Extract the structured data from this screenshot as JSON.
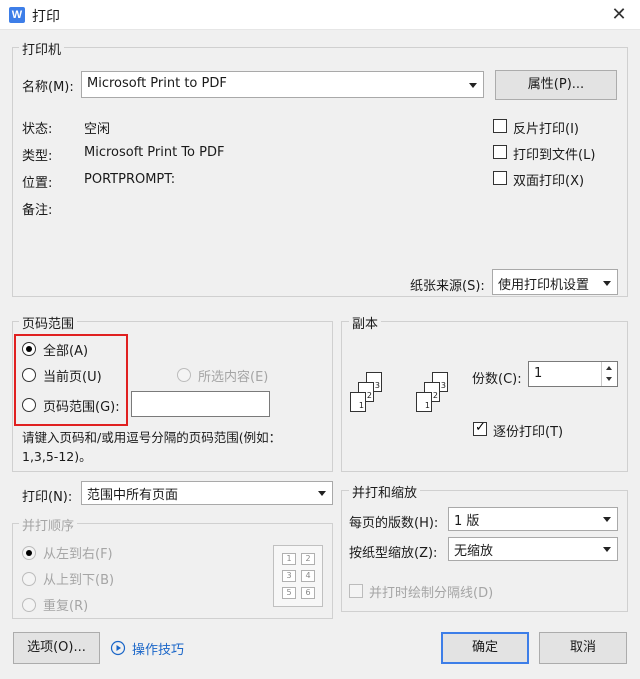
{
  "window": {
    "title": "打印",
    "app_icon": "W"
  },
  "printer": {
    "group_title": "打印机",
    "name_label": "名称(M):",
    "name_value": "Microsoft Print to PDF",
    "properties_button": "属性(P)...",
    "status_label": "状态:",
    "status_value": "空闲",
    "type_label": "类型:",
    "type_value": "Microsoft Print To PDF",
    "location_label": "位置:",
    "location_value": "PORTPROMPT:",
    "comment_label": "备注:",
    "reverse_print": "反片打印(I)",
    "print_to_file": "打印到文件(L)",
    "duplex_print": "双面打印(X)",
    "paper_source_label": "纸张来源(S):",
    "paper_source_value": "使用打印机设置"
  },
  "page_range": {
    "group_title": "页码范围",
    "all": "全部(A)",
    "current": "当前页(U)",
    "selection": "所选内容(E)",
    "pages": "页码范围(G):",
    "pages_value": "",
    "hint": "请键入页码和/或用逗号分隔的页码范围(例如：",
    "hint_example": "1,3,5-12)。"
  },
  "copies": {
    "group_title": "副本",
    "count_label": "份数(C):",
    "count_value": "1",
    "collate": "逐份打印(T)"
  },
  "print_what": {
    "label": "打印(N):",
    "value": "范围中所有页面"
  },
  "order": {
    "group_title": "并打顺序",
    "left_to_right": "从左到右(F)",
    "top_to_bottom": "从上到下(B)",
    "repeat": "重复(R)",
    "grid": [
      "1",
      "2",
      "3",
      "4",
      "5",
      "6"
    ]
  },
  "zoom": {
    "group_title": "并打和缩放",
    "pages_per_sheet_label": "每页的版数(H):",
    "pages_per_sheet_value": "1 版",
    "scale_label": "按纸型缩放(Z):",
    "scale_value": "无缩放",
    "draw_borders": "并打时绘制分隔线(D)"
  },
  "footer": {
    "options_button": "选项(O)...",
    "tips_link": "操作技巧",
    "ok_button": "确定",
    "cancel_button": "取消"
  },
  "colors": {
    "accent": "#3d7ee8",
    "highlight_box": "#e02020",
    "link": "#1a66c8"
  }
}
